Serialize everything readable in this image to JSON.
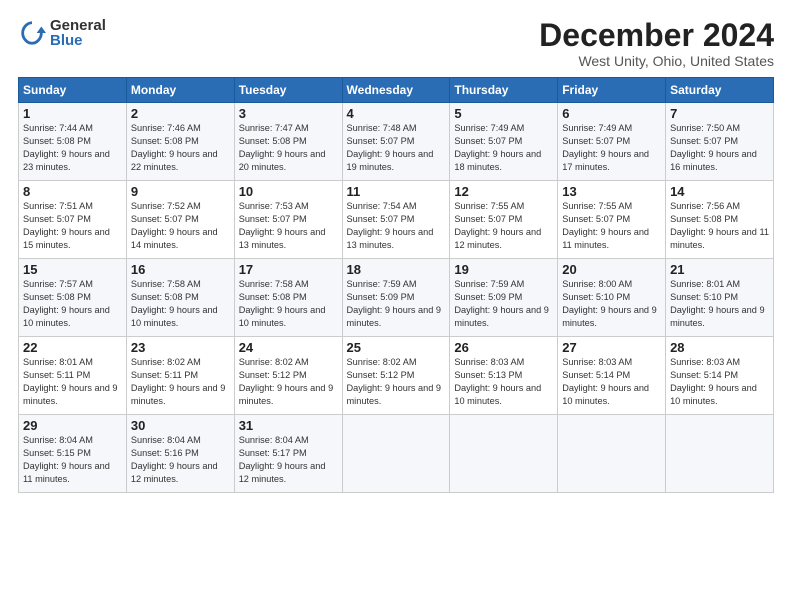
{
  "logo": {
    "general": "General",
    "blue": "Blue"
  },
  "title": "December 2024",
  "location": "West Unity, Ohio, United States",
  "days_header": [
    "Sunday",
    "Monday",
    "Tuesday",
    "Wednesday",
    "Thursday",
    "Friday",
    "Saturday"
  ],
  "weeks": [
    [
      {
        "day": "1",
        "sunrise": "7:44 AM",
        "sunset": "5:08 PM",
        "daylight": "9 hours and 23 minutes."
      },
      {
        "day": "2",
        "sunrise": "7:46 AM",
        "sunset": "5:08 PM",
        "daylight": "9 hours and 22 minutes."
      },
      {
        "day": "3",
        "sunrise": "7:47 AM",
        "sunset": "5:08 PM",
        "daylight": "9 hours and 20 minutes."
      },
      {
        "day": "4",
        "sunrise": "7:48 AM",
        "sunset": "5:07 PM",
        "daylight": "9 hours and 19 minutes."
      },
      {
        "day": "5",
        "sunrise": "7:49 AM",
        "sunset": "5:07 PM",
        "daylight": "9 hours and 18 minutes."
      },
      {
        "day": "6",
        "sunrise": "7:49 AM",
        "sunset": "5:07 PM",
        "daylight": "9 hours and 17 minutes."
      },
      {
        "day": "7",
        "sunrise": "7:50 AM",
        "sunset": "5:07 PM",
        "daylight": "9 hours and 16 minutes."
      }
    ],
    [
      {
        "day": "8",
        "sunrise": "7:51 AM",
        "sunset": "5:07 PM",
        "daylight": "9 hours and 15 minutes."
      },
      {
        "day": "9",
        "sunrise": "7:52 AM",
        "sunset": "5:07 PM",
        "daylight": "9 hours and 14 minutes."
      },
      {
        "day": "10",
        "sunrise": "7:53 AM",
        "sunset": "5:07 PM",
        "daylight": "9 hours and 13 minutes."
      },
      {
        "day": "11",
        "sunrise": "7:54 AM",
        "sunset": "5:07 PM",
        "daylight": "9 hours and 13 minutes."
      },
      {
        "day": "12",
        "sunrise": "7:55 AM",
        "sunset": "5:07 PM",
        "daylight": "9 hours and 12 minutes."
      },
      {
        "day": "13",
        "sunrise": "7:55 AM",
        "sunset": "5:07 PM",
        "daylight": "9 hours and 11 minutes."
      },
      {
        "day": "14",
        "sunrise": "7:56 AM",
        "sunset": "5:08 PM",
        "daylight": "9 hours and 11 minutes."
      }
    ],
    [
      {
        "day": "15",
        "sunrise": "7:57 AM",
        "sunset": "5:08 PM",
        "daylight": "9 hours and 10 minutes."
      },
      {
        "day": "16",
        "sunrise": "7:58 AM",
        "sunset": "5:08 PM",
        "daylight": "9 hours and 10 minutes."
      },
      {
        "day": "17",
        "sunrise": "7:58 AM",
        "sunset": "5:08 PM",
        "daylight": "9 hours and 10 minutes."
      },
      {
        "day": "18",
        "sunrise": "7:59 AM",
        "sunset": "5:09 PM",
        "daylight": "9 hours and 9 minutes."
      },
      {
        "day": "19",
        "sunrise": "7:59 AM",
        "sunset": "5:09 PM",
        "daylight": "9 hours and 9 minutes."
      },
      {
        "day": "20",
        "sunrise": "8:00 AM",
        "sunset": "5:10 PM",
        "daylight": "9 hours and 9 minutes."
      },
      {
        "day": "21",
        "sunrise": "8:01 AM",
        "sunset": "5:10 PM",
        "daylight": "9 hours and 9 minutes."
      }
    ],
    [
      {
        "day": "22",
        "sunrise": "8:01 AM",
        "sunset": "5:11 PM",
        "daylight": "9 hours and 9 minutes."
      },
      {
        "day": "23",
        "sunrise": "8:02 AM",
        "sunset": "5:11 PM",
        "daylight": "9 hours and 9 minutes."
      },
      {
        "day": "24",
        "sunrise": "8:02 AM",
        "sunset": "5:12 PM",
        "daylight": "9 hours and 9 minutes."
      },
      {
        "day": "25",
        "sunrise": "8:02 AM",
        "sunset": "5:12 PM",
        "daylight": "9 hours and 9 minutes."
      },
      {
        "day": "26",
        "sunrise": "8:03 AM",
        "sunset": "5:13 PM",
        "daylight": "9 hours and 10 minutes."
      },
      {
        "day": "27",
        "sunrise": "8:03 AM",
        "sunset": "5:14 PM",
        "daylight": "9 hours and 10 minutes."
      },
      {
        "day": "28",
        "sunrise": "8:03 AM",
        "sunset": "5:14 PM",
        "daylight": "9 hours and 10 minutes."
      }
    ],
    [
      {
        "day": "29",
        "sunrise": "8:04 AM",
        "sunset": "5:15 PM",
        "daylight": "9 hours and 11 minutes."
      },
      {
        "day": "30",
        "sunrise": "8:04 AM",
        "sunset": "5:16 PM",
        "daylight": "9 hours and 12 minutes."
      },
      {
        "day": "31",
        "sunrise": "8:04 AM",
        "sunset": "5:17 PM",
        "daylight": "9 hours and 12 minutes."
      },
      null,
      null,
      null,
      null
    ]
  ]
}
